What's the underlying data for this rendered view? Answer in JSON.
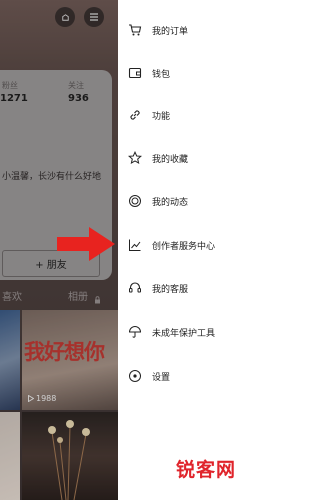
{
  "profile": {
    "stats": [
      {
        "label": "粉丝",
        "value": "1271"
      },
      {
        "label": "关注",
        "value": "936"
      }
    ],
    "bio_lines": [
      "小温馨，长沙有什么好地"
    ],
    "friend_button": "+ 朋友",
    "tabs": {
      "left": "喜欢",
      "right": "相册"
    },
    "video_overlay_text": "我好想你",
    "play_count": "1988"
  },
  "drawer": {
    "items": [
      {
        "label": "我的订单",
        "icon": "cart-icon"
      },
      {
        "label": "钱包",
        "icon": "wallet-icon"
      },
      {
        "label": "功能",
        "icon": "link-icon"
      },
      {
        "label": "我的收藏",
        "icon": "star-icon"
      },
      {
        "label": "我的动态",
        "icon": "activity-icon"
      },
      {
        "label": "创作者服务中心",
        "icon": "chart-icon"
      },
      {
        "label": "我的客服",
        "icon": "headset-icon"
      },
      {
        "label": "未成年保护工具",
        "icon": "umbrella-icon"
      },
      {
        "label": "设置",
        "icon": "settings-icon"
      }
    ]
  },
  "watermark": "锐客网",
  "colors": {
    "accent_arrow": "#e8231f",
    "watermark": "#e0242b"
  }
}
